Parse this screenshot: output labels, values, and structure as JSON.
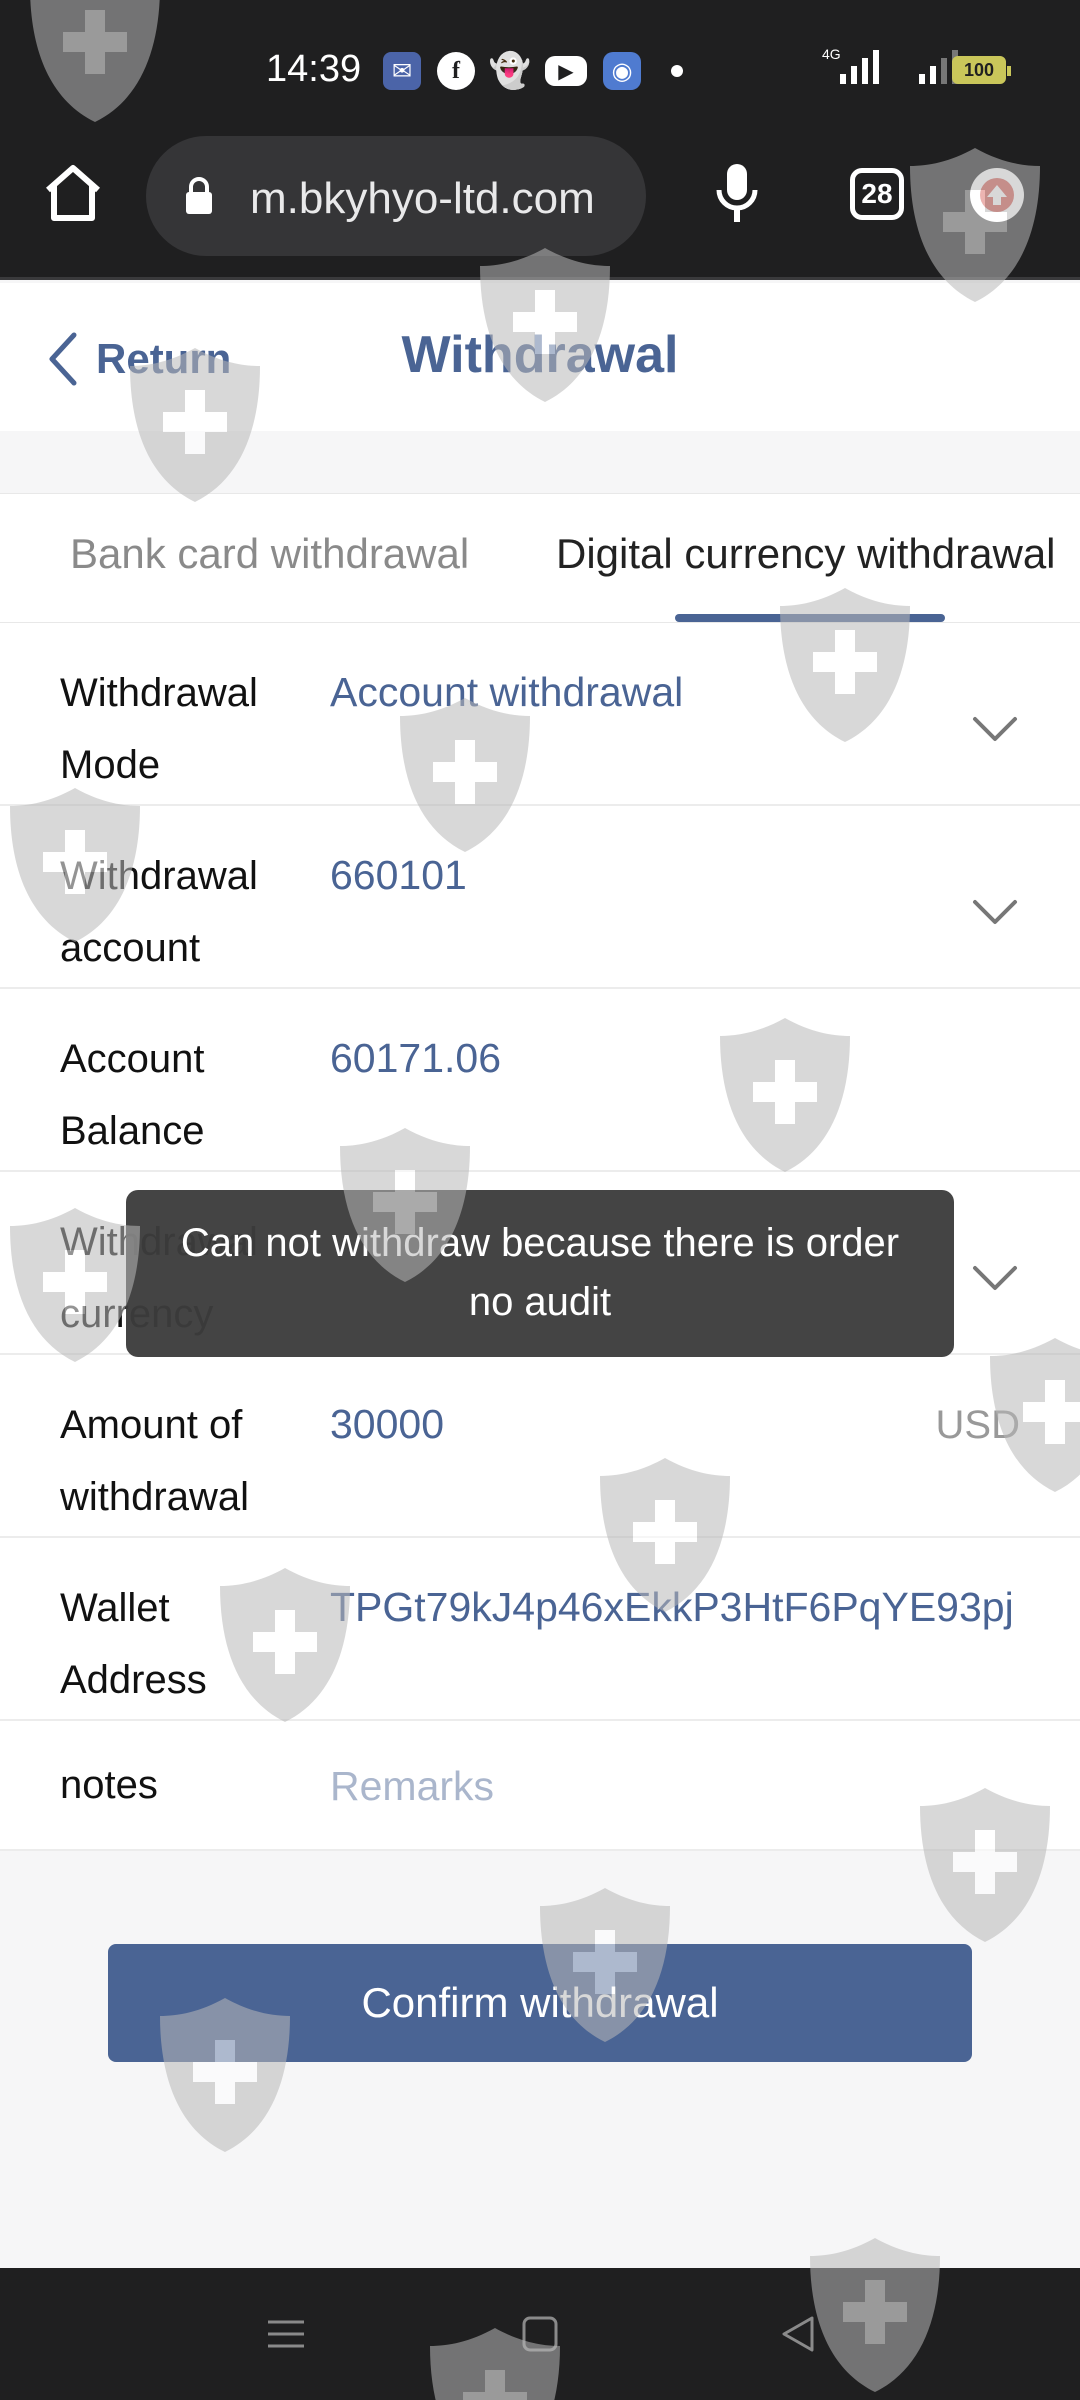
{
  "status_bar": {
    "time": "14:39",
    "network_label": "4G",
    "battery": "100"
  },
  "browser": {
    "url": "m.bkyhyo-ltd.com",
    "tab_count": "28"
  },
  "header": {
    "return_label": "Return",
    "title": "Withdrawal"
  },
  "tabs": [
    {
      "label": "Bank card withdrawal",
      "active": false
    },
    {
      "label": "Digital currency withdrawal",
      "active": true
    }
  ],
  "form": {
    "mode": {
      "label": "Withdrawal Mode",
      "value": "Account withdrawal"
    },
    "account": {
      "label": "Withdrawal account",
      "value": "660101"
    },
    "balance": {
      "label": "Account Balance",
      "value": "60171.06"
    },
    "currency": {
      "label": "Withdrawal currency",
      "value": ""
    },
    "amount": {
      "label": "Amount of withdrawal",
      "value": "30000",
      "unit": "USD"
    },
    "wallet": {
      "label": "Wallet Address",
      "value": "TPGt79kJ4p46xEkkP3HtF6PqYE93pj"
    },
    "notes": {
      "label": "notes",
      "placeholder": "Remarks"
    }
  },
  "confirm_label": "Confirm withdrawal",
  "toast": "Can not withdraw because there is order no audit",
  "colors": {
    "accent": "#4a6494",
    "status_bg": "#1f1f20",
    "page_bg": "#f6f6f7"
  }
}
